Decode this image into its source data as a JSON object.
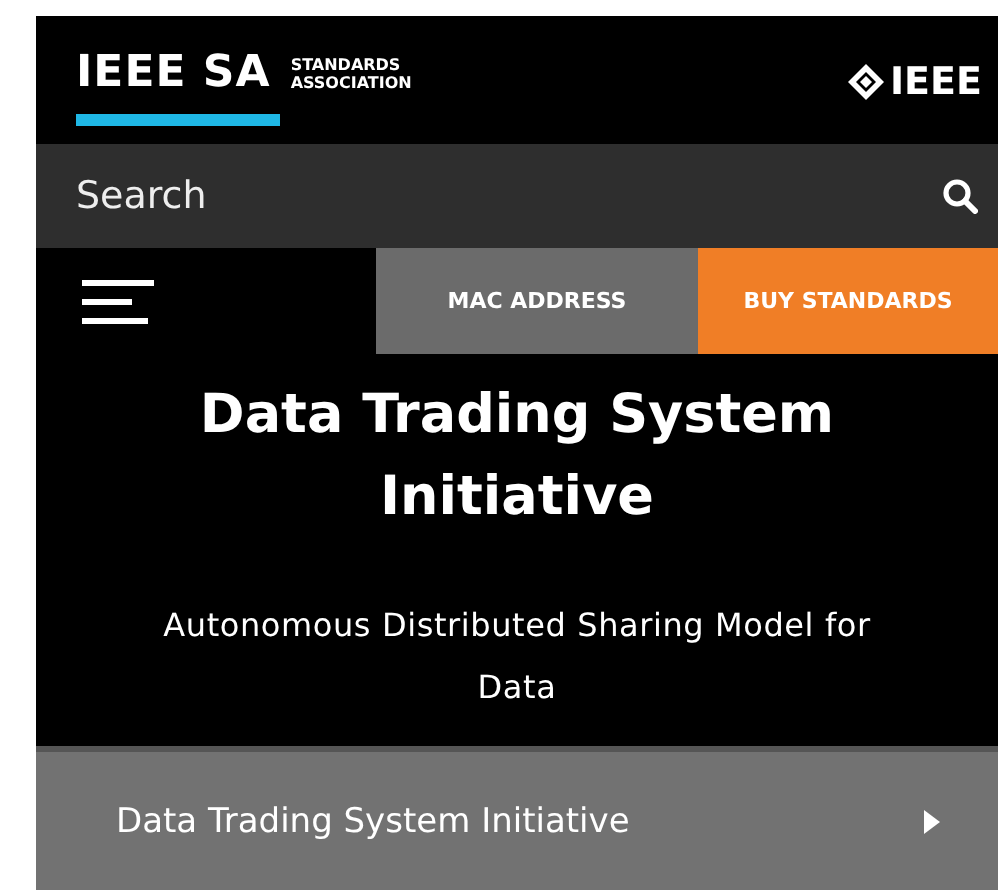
{
  "header": {
    "logo": "IEEE SA",
    "logo_subtitle": [
      "STANDARDS",
      "ASSOCIATION"
    ],
    "brand": "IEEE"
  },
  "search": {
    "placeholder": "Search"
  },
  "nav": {
    "buttons": [
      {
        "label": "MAC ADDRESS",
        "kind": "secondary"
      },
      {
        "label": "BUY STANDARDS",
        "kind": "primary"
      }
    ]
  },
  "hero": {
    "title": "Data Trading System Initiative",
    "subtitle": "Autonomous Distributed Sharing Model for Data"
  },
  "menu_items": [
    {
      "label": "Data Trading System Initiative"
    }
  ]
}
